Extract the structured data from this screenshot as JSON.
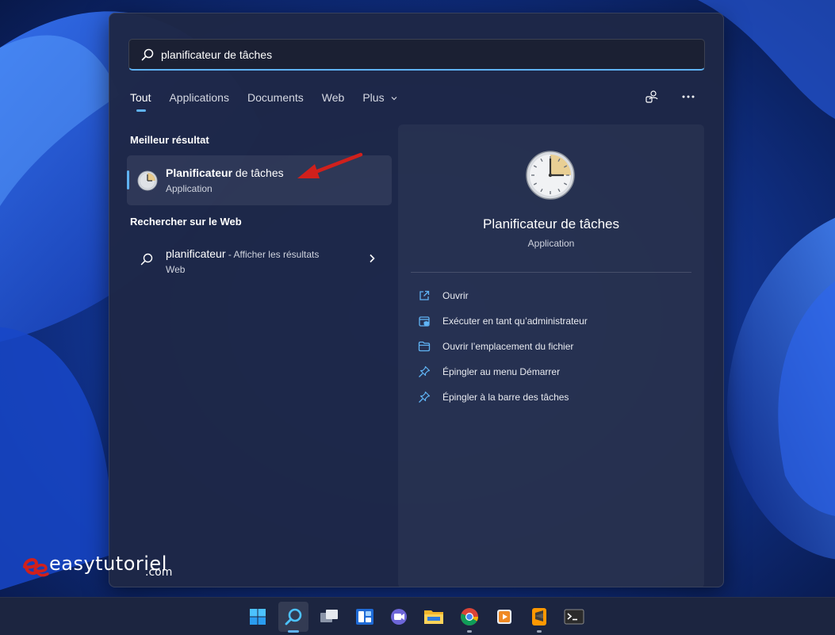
{
  "search": {
    "query": "planificateur de tâches"
  },
  "tabs": [
    {
      "label": "Tout",
      "active": true
    },
    {
      "label": "Applications",
      "active": false
    },
    {
      "label": "Documents",
      "active": false
    },
    {
      "label": "Web",
      "active": false
    },
    {
      "label": "Plus",
      "active": false
    }
  ],
  "tab_icons": [
    "account-switch-icon",
    "more-options-icon"
  ],
  "best_match": {
    "heading": "Meilleur résultat",
    "title_bold": "Planificateur",
    "title_rest": " de tâches",
    "subtitle": "Application",
    "icon": "task-scheduler-clock-icon"
  },
  "web_search": {
    "heading": "Rechercher sur le Web",
    "query": "planificateur",
    "suffix": " - Afficher les résultats",
    "subtitle": "Web"
  },
  "details": {
    "title": "Planificateur de tâches",
    "subtitle": "Application",
    "actions": [
      {
        "label": "Ouvrir",
        "icon": "open-external-icon"
      },
      {
        "label": "Exécuter en tant qu’administrateur",
        "icon": "run-as-admin-icon"
      },
      {
        "label": "Ouvrir l’emplacement du fichier",
        "icon": "folder-icon"
      },
      {
        "label": "Épingler au menu Démarrer",
        "icon": "pin-icon"
      },
      {
        "label": "Épingler à la barre des tâches",
        "icon": "pin-icon"
      }
    ]
  },
  "watermark": {
    "text": "easytutoriel",
    "suffix": ".com"
  },
  "taskbar": {
    "items": [
      "start-icon",
      "search-icon",
      "task-view-icon",
      "widgets-icon",
      "teams-chat-icon",
      "file-explorer-icon",
      "chrome-icon",
      "media-player-icon",
      "sublime-text-icon",
      "terminal-icon"
    ]
  },
  "colors": {
    "accent": "#5fb2f2",
    "panel": "#1e2746",
    "annotation_arrow": "#d0201c"
  }
}
